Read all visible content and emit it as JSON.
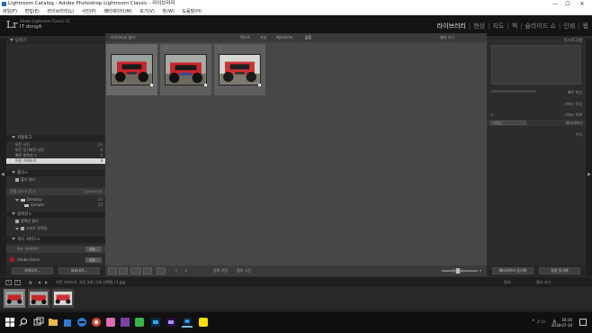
{
  "window": {
    "title": "Lightroom Catalog - Adobe Photoshop Lightroom Classic - 라이브러리",
    "minimize": "—",
    "maximize": "☐",
    "close": "✕"
  },
  "menu": [
    "파일(F)",
    "편집(E)",
    "라이브러리(L)",
    "사진(P)",
    "메타데이터(M)",
    "보기(V)",
    "창(W)",
    "도움말(H)"
  ],
  "identity": {
    "logo": "Lr",
    "catalog_label": "Adobe Lightroom Classic CC",
    "user": "IT dongA"
  },
  "modules": [
    {
      "label": "라이브러리",
      "active": true
    },
    {
      "label": "현상",
      "active": false
    },
    {
      "label": "지도",
      "active": false
    },
    {
      "label": "책",
      "active": false
    },
    {
      "label": "슬라이드 쇼",
      "active": false
    },
    {
      "label": "인쇄",
      "active": false
    },
    {
      "label": "웹",
      "active": false
    }
  ],
  "module_separator": "|",
  "left_panel": {
    "navigator": "탐색기",
    "catalog": {
      "header": "카탈로그",
      "items": [
        {
          "label": "모든 사진",
          "count": "23"
        },
        {
          "label": "모든 동기화된 사진",
          "count": "0"
        },
        {
          "label": "빠른 컬렉션 +",
          "count": "0"
        },
        {
          "label": "이전 가져오기",
          "count": "3",
          "selected": true
        }
      ]
    },
    "folders": {
      "header": "폴더",
      "add": "+",
      "search_placeholder": "폴더 필터",
      "volume": "로컬 디스크 (C:)",
      "volume_size": "204/465GB",
      "items": [
        {
          "label": "Desktop",
          "count": "23"
        },
        {
          "label": "Sample",
          "count": "23"
        }
      ]
    },
    "collections": {
      "header": "컬렉션",
      "add": "+",
      "search_placeholder": "컬렉션 필터",
      "items": [
        {
          "label": "스마트 컬렉션"
        }
      ]
    },
    "publish": {
      "header": "게시 서비스",
      "add": "+",
      "hard_drive": "하드 드라이브",
      "setup": "설정...",
      "adobe_stock": "Adobe Stock",
      "adobe_setup": "설정..."
    },
    "import_button": "가져오기...",
    "export_button": "내보내기..."
  },
  "center": {
    "filter_label": "라이브러리 필터:",
    "filter_tabs": [
      "텍스트",
      "속성",
      "메타데이터",
      "없음"
    ],
    "filter_off": "필터 끄기",
    "grid_cells": [
      {
        "index": "1",
        "selected": true
      },
      {
        "index": "2",
        "selected": false
      },
      {
        "index": "3",
        "selected": false
      }
    ],
    "sort_label": "정렬 기준:",
    "sort_value": "캡처 시간",
    "thumbnails_label": "썸네일"
  },
  "right_panel": {
    "histogram": "히스토그램",
    "quick_develop": "빠른 현상",
    "keywording": "키워드 작성",
    "keyword_list": "키워드 목록",
    "default": "기본값",
    "metadata": "메타데이터",
    "comments": "주석",
    "sync_metadata": "메타데이터 동기화",
    "sync_settings": "설정 동기화"
  },
  "filmstrip": {
    "panel_number": "1",
    "panel_number_2": "2",
    "source": "이전 가져오기",
    "count": "사진 3개 / 1개 선택됨 / 1.jpg",
    "filter": "필터:",
    "filter_off": "필터 끄기",
    "thumbs": 3
  },
  "taskbar": {
    "time": "16:10",
    "date": "2018-07-10",
    "lang": "A",
    "tray": "^ ♪ ▭"
  },
  "colors": {
    "panel_bg": "#2c2c2c",
    "center_bg": "#474747",
    "jeep_red": "#c8262b",
    "accent": "#76b9ed"
  }
}
